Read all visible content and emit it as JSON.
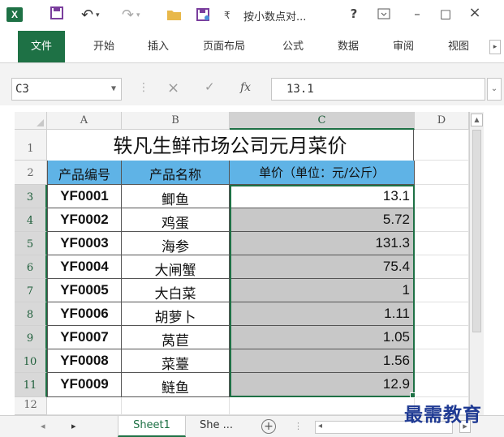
{
  "titlebar": {
    "app_icon": "X",
    "save_icon": "save-icon",
    "undo_glyph": "↶",
    "redo_glyph": "↷",
    "title": "按小数点对...",
    "help": "?",
    "minimize": "–",
    "maximize": "□",
    "close": "×"
  },
  "ribbon": {
    "tabs": [
      "文件",
      "开始",
      "插入",
      "页面布局",
      "公式",
      "数据",
      "审阅",
      "视图"
    ],
    "scroll": "▸"
  },
  "formula_bar": {
    "name_box": "C3",
    "cancel": "×",
    "enter": "✓",
    "fx": "fx",
    "value": "13.1"
  },
  "columns": [
    "A",
    "B",
    "C",
    "D"
  ],
  "rows": [
    "1",
    "2",
    "3",
    "4",
    "5",
    "6",
    "7",
    "8",
    "9",
    "10",
    "11",
    "12"
  ],
  "sheet": {
    "title": "轶凡生鲜市场公司元月菜价",
    "headers": [
      "产品编号",
      "产品名称",
      "单价（单位：元/公斤）"
    ],
    "data": [
      {
        "code": "YF0001",
        "name": "鲫鱼",
        "price": "13.1"
      },
      {
        "code": "YF0002",
        "name": "鸡蛋",
        "price": "5.72"
      },
      {
        "code": "YF0003",
        "name": "海参",
        "price": "131.3"
      },
      {
        "code": "YF0004",
        "name": "大闸蟹",
        "price": "75.4"
      },
      {
        "code": "YF0005",
        "name": "大白菜",
        "price": "1"
      },
      {
        "code": "YF0006",
        "name": "胡萝卜",
        "price": "1.11"
      },
      {
        "code": "YF0007",
        "name": "莴苣",
        "price": "1.05"
      },
      {
        "code": "YF0008",
        "name": "菜薹",
        "price": "1.56"
      },
      {
        "code": "YF0009",
        "name": "鲢鱼",
        "price": "12.9"
      }
    ]
  },
  "sheet_tabs": {
    "active": "Sheet1",
    "next": "She ...",
    "add": "+"
  },
  "watermark": "最需教育",
  "colors": {
    "excel_green": "#1e7145",
    "header_blue": "#5fb3e6",
    "selection_gray": "#c8c8c8"
  }
}
